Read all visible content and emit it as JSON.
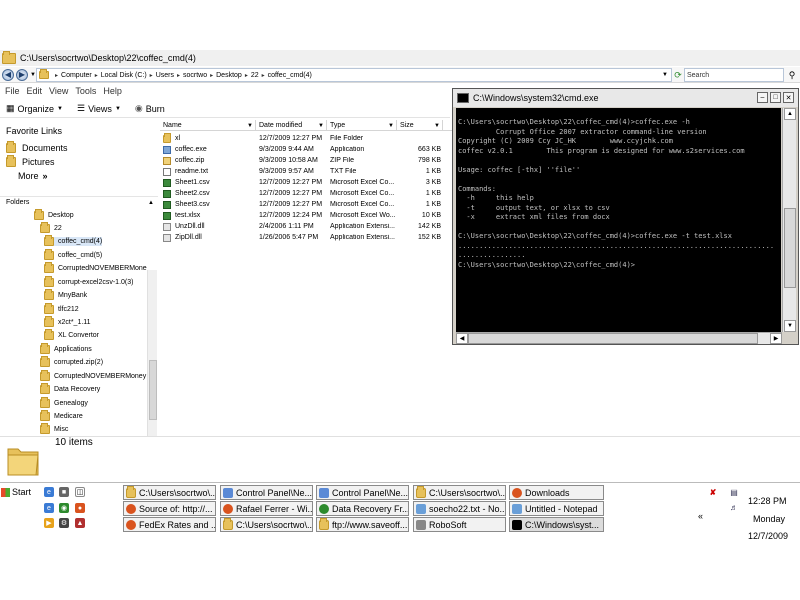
{
  "explorer": {
    "title": "C:\\Users\\socrtwo\\Desktop\\22\\coffec_cmd(4)",
    "address": [
      "Computer",
      "Local Disk (C:)",
      "Users",
      "socrtwo",
      "Desktop",
      "22",
      "coffec_cmd(4)"
    ],
    "search_placeholder": "Search",
    "menu": [
      "File",
      "Edit",
      "View",
      "Tools",
      "Help"
    ],
    "toolbar": {
      "organize": "Organize",
      "views": "Views",
      "burn": "Burn"
    },
    "favorites_title": "Favorite Links",
    "favorites": [
      "Documents",
      "Pictures",
      "More"
    ],
    "more_chevrons": "»",
    "folders_label": "Folders",
    "tree": [
      "Desktop",
      "22",
      "coffec_cmd(4)",
      "coffec_cmd(5)",
      "CorruptedNOVEMBERMone",
      "corrupt-excel2csv-1.0(3)",
      "MnyBank",
      "tlfc212",
      "x2ct*_1.11",
      "XL Convertor",
      "Applications",
      "corrupted.zip(2)",
      "CorruptedNOVEMBERMoney",
      "Data Recovery",
      "Genealogy",
      "Medicare",
      "Misc"
    ],
    "columns": [
      "Name",
      "Date modified",
      "Type",
      "Size"
    ],
    "files": [
      {
        "name": "xl",
        "date": "12/7/2009 12:27 PM",
        "type": "File Folder",
        "size": "",
        "icon": "folder"
      },
      {
        "name": "coffec.exe",
        "date": "9/3/2009 9:44 AM",
        "type": "Application",
        "size": "663 KB",
        "icon": "exe"
      },
      {
        "name": "coffec.zip",
        "date": "9/3/2009 10:58 AM",
        "type": "ZIP File",
        "size": "798 KB",
        "icon": "zip"
      },
      {
        "name": "readme.txt",
        "date": "9/3/2009 9:57 AM",
        "type": "TXT File",
        "size": "1 KB",
        "icon": "txt"
      },
      {
        "name": "Sheet1.csv",
        "date": "12/7/2009 12:27 PM",
        "type": "Microsoft Excel Co...",
        "size": "3 KB",
        "icon": "excel"
      },
      {
        "name": "Sheet2.csv",
        "date": "12/7/2009 12:27 PM",
        "type": "Microsoft Excel Co...",
        "size": "1 KB",
        "icon": "excel"
      },
      {
        "name": "Sheet3.csv",
        "date": "12/7/2009 12:27 PM",
        "type": "Microsoft Excel Co...",
        "size": "1 KB",
        "icon": "excel"
      },
      {
        "name": "test.xlsx",
        "date": "12/7/2009 12:24 PM",
        "type": "Microsoft Excel Wo...",
        "size": "10 KB",
        "icon": "excel"
      },
      {
        "name": "UnzDll.dll",
        "date": "2/4/2006 1:11 PM",
        "type": "Application Extensi...",
        "size": "142 KB",
        "icon": "dll"
      },
      {
        "name": "ZipDll.dll",
        "date": "1/26/2006 5:47 PM",
        "type": "Application Extensi...",
        "size": "152 KB",
        "icon": "dll"
      }
    ],
    "item_count": "10 items"
  },
  "cmd": {
    "title": "C:\\Windows\\system32\\cmd.exe",
    "lines": [
      "C:\\Users\\socrtwo\\Desktop\\22\\coffec_cmd(4)>coffec.exe -h",
      "         Corrupt Office 2007 extractor command-line version",
      "Copyright (C) 2009 Ccy JC_HK        www.ccyjchk.com",
      "coffec v2.0.1        This program is designed for www.s2services.com",
      "",
      "Usage: coffec [-thx] ''file''",
      "",
      "Commands:",
      "  -h     this help",
      "  -t     output text, or xlsx to csv",
      "  -x     extract xml files from docx",
      "",
      "C:\\Users\\socrtwo\\Desktop\\22\\coffec_cmd(4)>coffec.exe -t test.xlsx",
      "...........................................................................",
      "................",
      "C:\\Users\\socrtwo\\Desktop\\22\\coffec_cmd(4)>"
    ]
  },
  "taskbar": {
    "start_label": "Start",
    "row1": [
      {
        "label": "C:\\Users\\socrtwo\\...",
        "color": "#e7c15b"
      },
      {
        "label": "Control Panel\\Ne...",
        "color": "#5b8ad6"
      },
      {
        "label": "Control Panel\\Ne...",
        "color": "#5b8ad6"
      },
      {
        "label": "C:\\Users\\socrtwo\\...",
        "color": "#e7c15b"
      },
      {
        "label": "Downloads",
        "color": "#d9531e"
      }
    ],
    "row2": [
      {
        "label": "Source of: http://...",
        "color": "#d9531e"
      },
      {
        "label": "Rafael Ferrer - Wi...",
        "color": "#d9531e"
      },
      {
        "label": "Data Recovery Fr...",
        "color": "#2d8a2d"
      },
      {
        "label": "soecho22.txt - No...",
        "color": "#6a9fd8"
      },
      {
        "label": "Untitled - Notepad",
        "color": "#6a9fd8"
      }
    ],
    "row3": [
      {
        "label": "FedEx Rates and ...",
        "color": "#d9531e"
      },
      {
        "label": "C:\\Users\\socrtwo\\...",
        "color": "#e7c15b"
      },
      {
        "label": "ftp://www.saveoff...",
        "color": "#e7c15b"
      },
      {
        "label": "RoboSoft",
        "color": "#888888"
      },
      {
        "label": "C:\\Windows\\syst...",
        "color": "#000000"
      }
    ],
    "tray_arrow": "«",
    "clock_time": "12:28 PM",
    "clock_day": "Monday",
    "clock_date": "12/7/2009"
  }
}
